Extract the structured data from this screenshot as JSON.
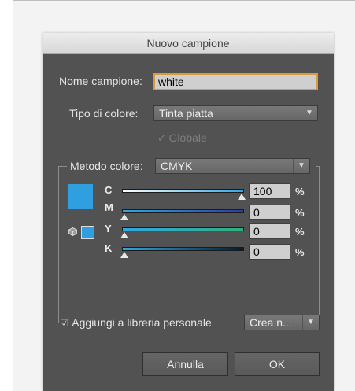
{
  "dialog": {
    "title": "Nuovo campione",
    "name_label": "Nome campione:",
    "name_value": "white",
    "type_label": "Tipo di colore:",
    "type_value": "Tinta piatta",
    "global_label": "Globale",
    "global_checked": true,
    "method_label": "Metodo colore:",
    "method_value": "CMYK",
    "swatch_color": "#2f9fe0",
    "channels": [
      {
        "label": "C",
        "value": "100",
        "percent": 1.0,
        "gradient": [
          "#ffffff",
          "#2fa8e6"
        ]
      },
      {
        "label": "M",
        "value": "0",
        "percent": 0.0,
        "gradient": [
          "#2fa8e6",
          "#2e3da0"
        ]
      },
      {
        "label": "Y",
        "value": "0",
        "percent": 0.0,
        "gradient": [
          "#2fa8e6",
          "#2fb07a"
        ]
      },
      {
        "label": "K",
        "value": "0",
        "percent": 0.0,
        "gradient": [
          "#2fa8e6",
          "#0a1a2a"
        ]
      }
    ],
    "percent_symbol": "%",
    "add_library_label": "Aggiungi a libreria personale",
    "add_library_checked": true,
    "create_label": "Crea n...",
    "cancel_label": "Annulla",
    "ok_label": "OK"
  }
}
